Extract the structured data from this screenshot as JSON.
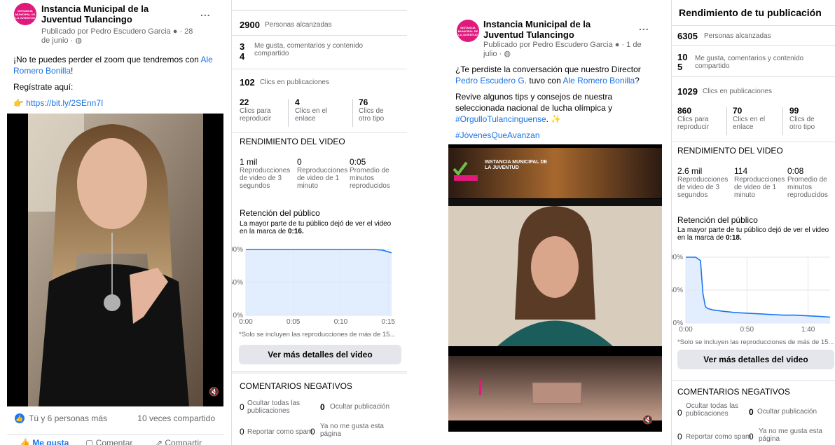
{
  "post1": {
    "logo_text": "INSTANCIA MUNICIPAL DE LA JUVENTUD",
    "page_name": "Instancia Municipal de la Juventud Tulancingo",
    "byline": "Publicado por Pedro Escudero Garcia",
    "date": "28 de junio",
    "more": "...",
    "line1": "¡No te puedes perder el zoom que tendremos con",
    "mention": "Ale Romero Bonilla",
    "excl": "!",
    "register": "Regístrate aquí:",
    "url": "https://bit.ly/2SEnn7I",
    "reactions": "Tú y 6 personas más",
    "shares": "10 veces compartido",
    "like": "Me gusta",
    "comment": "Comentar",
    "share": "Compartir"
  },
  "stats1": {
    "reach_value": "2900",
    "reach_label": "Personas alcanzadas",
    "engagement_top": "3",
    "engagement_bottom": "4",
    "engagement_label": "Me gusta, comentarios y contenido compartido",
    "clicks_value": "102",
    "clicks_label": "Clics en publicaciones",
    "c1_value": "22",
    "c1_label": "Clics para reproducir",
    "c2_value": "4",
    "c2_label": "Clics en el enlace",
    "c3_value": "76",
    "c3_label": "Clics de otro tipo",
    "video_title": "RENDIMIENTO DEL VIDEO",
    "v1_value": "1 mil",
    "v1_label": "Reproducciones de video de 3 segundos",
    "v2_value": "0",
    "v2_label": "Reproducciones de video de 1 minuto",
    "v3_value": "0:05",
    "v3_label": "Promedio de minutos reproducidos",
    "retention_title": "Retención del público",
    "retention_text": "La mayor parte de tu público dejó de ver el video en la marca de",
    "retention_mark": "0:16.",
    "note": "*Solo se incluyen las reproducciones de más de 15...",
    "button": "Ver más detalles del video",
    "neg_title": "COMENTARIOS NEGATIVOS",
    "n1_value": "0",
    "n1_label": "Ocultar todas las publicaciones",
    "n2_value": "0",
    "n2_label": "Ocultar publicación",
    "n3_value": "0",
    "n3_label": "Reportar como spam",
    "n4_value": "0",
    "n4_label": "Ya no me gusta esta página"
  },
  "post2": {
    "logo_text": "INSTANCIA MUNICIPAL DE LA JUVENTUD",
    "page_name": "Instancia Municipal de la Juventud Tulancingo",
    "byline": "Publicado por Pedro Escudero Garcia",
    "date": "1 de julio",
    "more": "...",
    "line1a": "¿Te perdiste la conversación que nuestro Director",
    "mention1": "Pedro Escudero G.",
    "line1b": "tuvo con",
    "mention2": "Ale Romero Bonilla",
    "q": "?",
    "line2": "Revive algunos tips y consejos de nuestra seleccionada nacional de lucha olímpica y",
    "hashtag1": "#OrgulloTulancinguense",
    "hashtag2": "#JóvenesQueAvanzan",
    "video_banner": "INSTANCIA MUNICIPAL DE LA JUVENTUD"
  },
  "stats2": {
    "header": "Rendimiento de tu publicación",
    "reach_value": "6305",
    "reach_label": "Personas alcanzadas",
    "engagement_top": "10",
    "engagement_bottom": "5",
    "engagement_label": "Me gusta, comentarios y contenido compartido",
    "clicks_value": "1029",
    "clicks_label": "Clics en publicaciones",
    "c1_value": "860",
    "c1_label": "Clics para reproducir",
    "c2_value": "70",
    "c2_label": "Clics en el enlace",
    "c3_value": "99",
    "c3_label": "Clics de otro tipo",
    "video_title": "RENDIMIENTO DEL VIDEO",
    "v1_value": "2.6 mil",
    "v1_label": "Reproducciones de video de 3 segundos",
    "v2_value": "114",
    "v2_label": "Reproducciones de video de 1 minuto",
    "v3_value": "0:08",
    "v3_label": "Promedio de minutos reproducidos",
    "retention_title": "Retención del público",
    "retention_text": "La mayor parte de tu público dejó de ver el video en la marca de",
    "retention_mark": "0:18.",
    "note": "*Solo se incluyen las reproducciones de más de 15...",
    "button": "Ver más detalles del video",
    "neg_title": "COMENTARIOS NEGATIVOS",
    "n1_value": "0",
    "n1_label": "Ocultar todas las publicaciones",
    "n2_value": "0",
    "n2_label": "Ocultar publicación",
    "n3_value": "0",
    "n3_label": "Reportar como spam",
    "n4_value": "0",
    "n4_label": "Ya no me gusta esta página"
  },
  "chart_data": [
    {
      "type": "area",
      "title": "Retención del público",
      "x": [
        0,
        1,
        2,
        3,
        4,
        5,
        6,
        7,
        8,
        9,
        10,
        11,
        12,
        13,
        14,
        15,
        16
      ],
      "y": [
        100,
        100,
        100,
        100,
        100,
        100,
        100,
        100,
        100,
        100,
        100,
        100,
        100,
        100,
        100,
        99,
        95
      ],
      "x_ticks": [
        "0:00",
        "0:05",
        "0:10",
        "0:15"
      ],
      "y_ticks": [
        "0%",
        "50%",
        "100%"
      ],
      "xlim": [
        0,
        16
      ],
      "ylim": [
        0,
        100
      ]
    },
    {
      "type": "area",
      "title": "Retención del público",
      "x": [
        0,
        8,
        12,
        14,
        16,
        18,
        22,
        30,
        40,
        50,
        60,
        70,
        80,
        90,
        100,
        110,
        118
      ],
      "y": [
        100,
        100,
        95,
        45,
        25,
        22,
        20,
        18,
        16,
        15,
        14,
        13,
        12,
        12,
        11,
        10,
        9
      ],
      "x_ticks": [
        "0:00",
        "0:50",
        "1:40"
      ],
      "y_ticks": [
        "0%",
        "50%",
        "100%"
      ],
      "xlim": [
        0,
        118
      ],
      "ylim": [
        0,
        100
      ]
    }
  ],
  "colors": {
    "link": "#1b74e4",
    "logo": "#e0197d",
    "chart_line": "#1877f2",
    "chart_fill": "#dbe9fc"
  }
}
